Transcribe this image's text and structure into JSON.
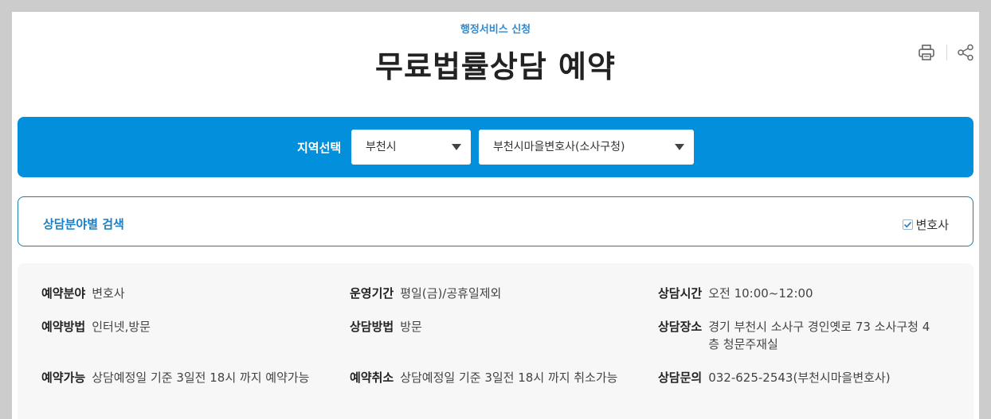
{
  "header": {
    "breadcrumb": "행정서비스 신청",
    "title": "무료법률상담 예약",
    "print_icon": "print-icon",
    "share_icon": "share-icon"
  },
  "region": {
    "label": "지역선택",
    "city_selected": "부천시",
    "office_selected": "부천시마을변호사(소사구청)"
  },
  "search": {
    "title": "상담분야별 검색",
    "checkbox_label": "변호사",
    "checkbox_checked": true
  },
  "info": {
    "field": {
      "key": "예약분야",
      "value": "변호사"
    },
    "period": {
      "key": "운영기간",
      "value": "평일(금)/공휴일제외"
    },
    "time": {
      "key": "상담시간",
      "value": "오전 10:00~12:00"
    },
    "method": {
      "key": "예약방법",
      "value": "인터넷,방문"
    },
    "consult_method": {
      "key": "상담방법",
      "value": "방문"
    },
    "place": {
      "key": "상담장소",
      "value": "경기 부천시 소사구 경인옛로 73  소사구청 4층 청문주재실"
    },
    "available": {
      "key": "예약가능",
      "value": "상담예정일 기준 3일전 18시 까지 예약가능"
    },
    "cancel": {
      "key": "예약취소",
      "value": "상담예정일 기준 3일전 18시 까지 취소가능"
    },
    "contact": {
      "key": "상담문의",
      "value": "032-625-2543(부천시마을변호사)"
    }
  },
  "colors": {
    "accent": "#0290dc",
    "link": "#2f8ad0",
    "border": "#1a7fa5"
  }
}
